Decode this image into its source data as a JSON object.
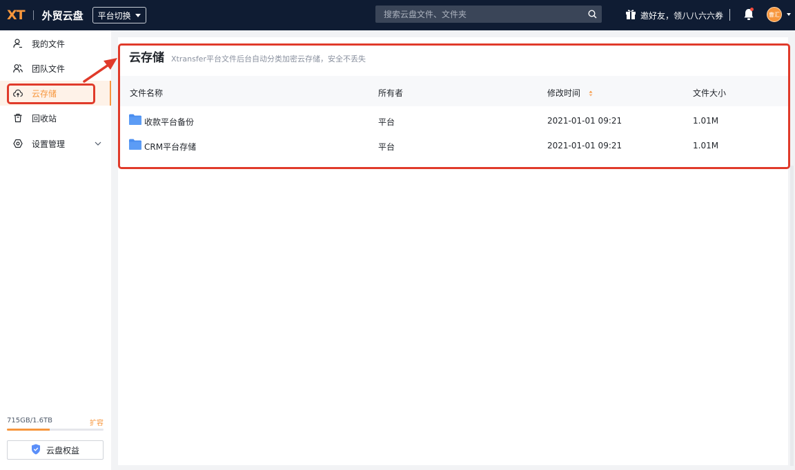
{
  "header": {
    "logo": "XT",
    "app_name": "外贸云盘",
    "platform_switch": "平台切换",
    "search_placeholder": "搜索云盘文件、文件夹",
    "invite_text": "邀好友，领八八六六券",
    "avatar_text": "曹汇"
  },
  "sidebar": {
    "items": [
      {
        "label": "我的文件",
        "icon": "user-file-icon"
      },
      {
        "label": "团队文件",
        "icon": "team-icon"
      },
      {
        "label": "云存储",
        "icon": "cloud-upload-icon",
        "active": true
      },
      {
        "label": "回收站",
        "icon": "trash-icon"
      },
      {
        "label": "设置管理",
        "icon": "gear-icon",
        "has_children": true
      }
    ],
    "storage_text": "715GB/1.6TB",
    "storage_used_fraction": 0.44,
    "expand_label": "扩容",
    "perk_button": "云盘权益"
  },
  "main": {
    "title": "云存储",
    "subtitle": "Xtransfer平台文件后台自动分类加密云存储，安全不丢失",
    "columns": [
      "文件名称",
      "所有者",
      "修改时间",
      "文件大小"
    ],
    "rows": [
      {
        "name": "收款平台备份",
        "owner": "平台",
        "modified": "2021-01-01 09:21",
        "size": "1.01M"
      },
      {
        "name": "CRM平台存储",
        "owner": "平台",
        "modified": "2021-01-01 09:21",
        "size": "1.01M"
      }
    ]
  },
  "colors": {
    "accent": "#f7963c",
    "topbar": "#0f1c33",
    "annotation": "#e03a2a",
    "folder": "#4a8ef0"
  }
}
